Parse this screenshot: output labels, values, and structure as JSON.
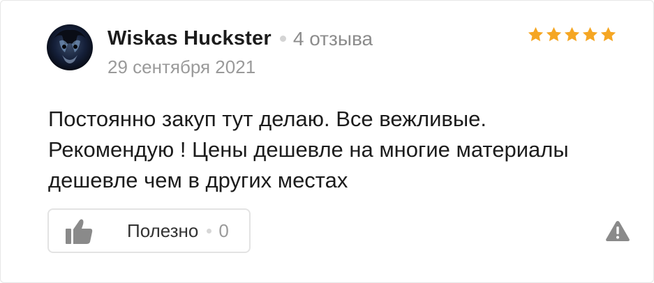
{
  "review": {
    "author_name": "Wiskas Huckster",
    "review_count": "4 отзыва",
    "date": "29 сентября 2021",
    "rating": 5,
    "text": "Постоянно закуп тут делаю. Все вежливые. Рекомендую ! Цены дешевле на многие материалы дешевле чем в других местах",
    "useful_label": "Полезно",
    "useful_count": "0"
  },
  "colors": {
    "star": "#f5a623",
    "muted_text": "#9a9a9a",
    "icon_gray": "#8a8a8a"
  },
  "icons": {
    "avatar": "avatar",
    "star": "star-icon",
    "thumb": "thumbs-up-icon",
    "report": "warning-triangle-icon"
  }
}
